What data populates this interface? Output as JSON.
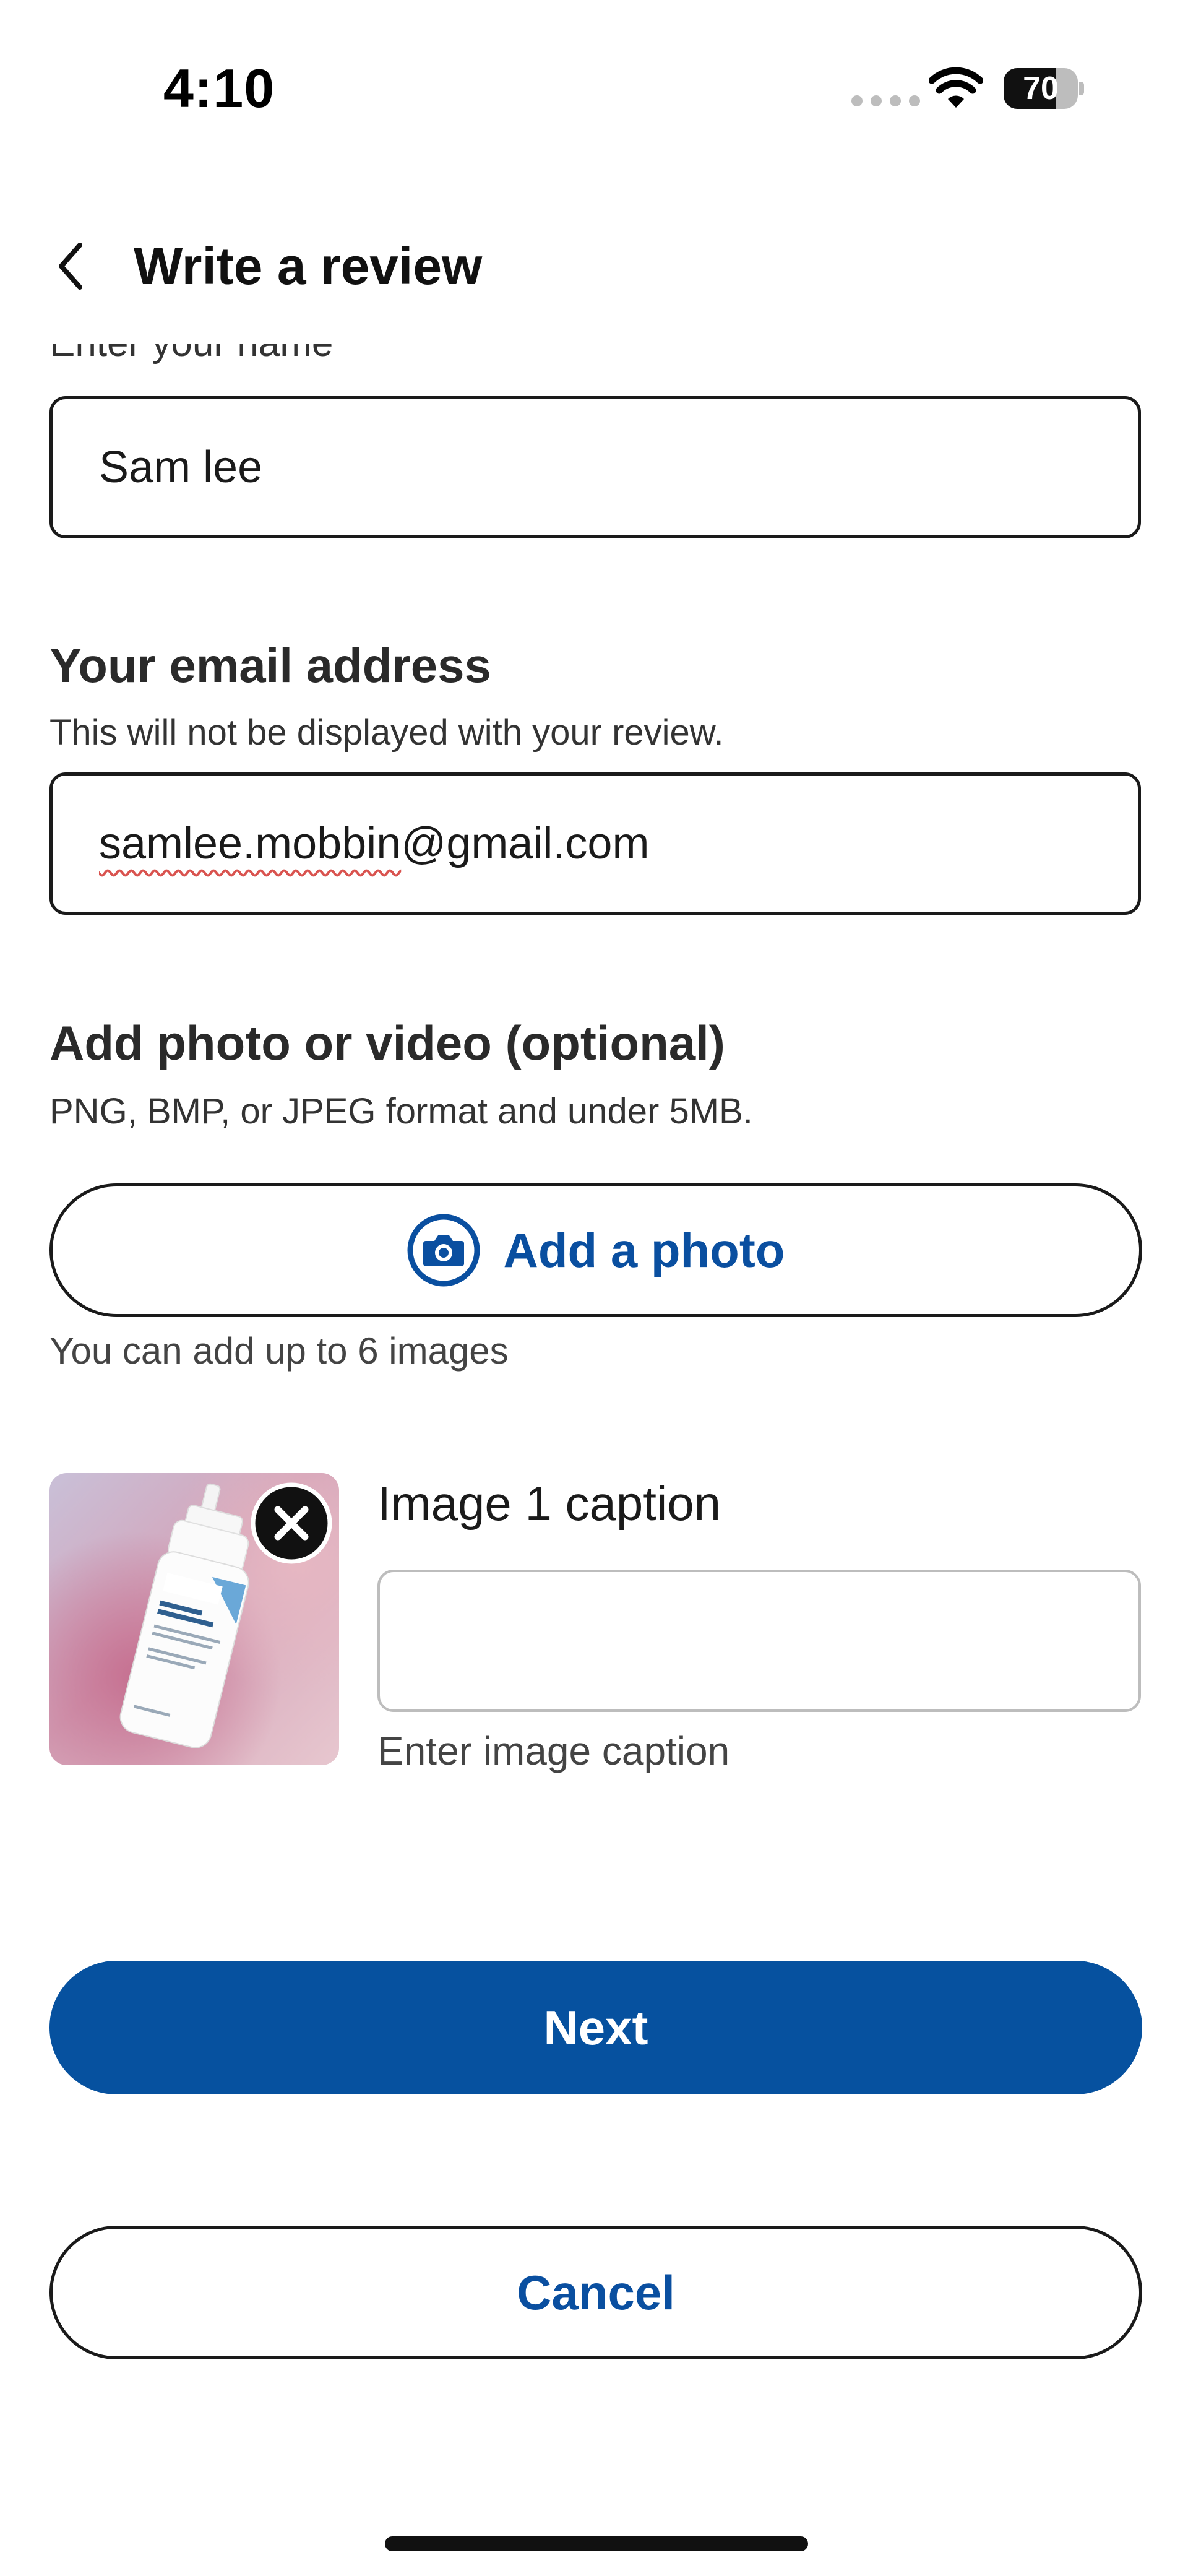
{
  "status_bar": {
    "time": "4:10",
    "battery_level": "70",
    "battery_fraction": 0.7
  },
  "header": {
    "title": "Write a review",
    "back_icon": "chevron-left-icon"
  },
  "form": {
    "name": {
      "label_partial": "Enter your name",
      "value": "Sam lee"
    },
    "email": {
      "title": "Your email address",
      "subtitle": "This will not be displayed with your review.",
      "value_local": "samlee.mobbin",
      "value_domain": "@gmail.com"
    },
    "media": {
      "title": "Add photo or video (optional)",
      "subtitle": "PNG, BMP, or JPEG format and under 5MB.",
      "add_button_label": "Add a photo",
      "add_button_icon": "camera-icon",
      "hint": "You can add up to 6 images"
    },
    "images": [
      {
        "thumbnail_icon": "product-photo-thumbnail",
        "remove_icon": "close-circle-icon",
        "caption_label": "Image 1 caption",
        "caption_value": "",
        "caption_hint": "Enter image caption"
      }
    ]
  },
  "actions": {
    "next_label": "Next",
    "cancel_label": "Cancel"
  },
  "colors": {
    "primary": "#06519f",
    "link_text": "#0a4fa0",
    "spellcheck_underline": "#d9534f"
  }
}
